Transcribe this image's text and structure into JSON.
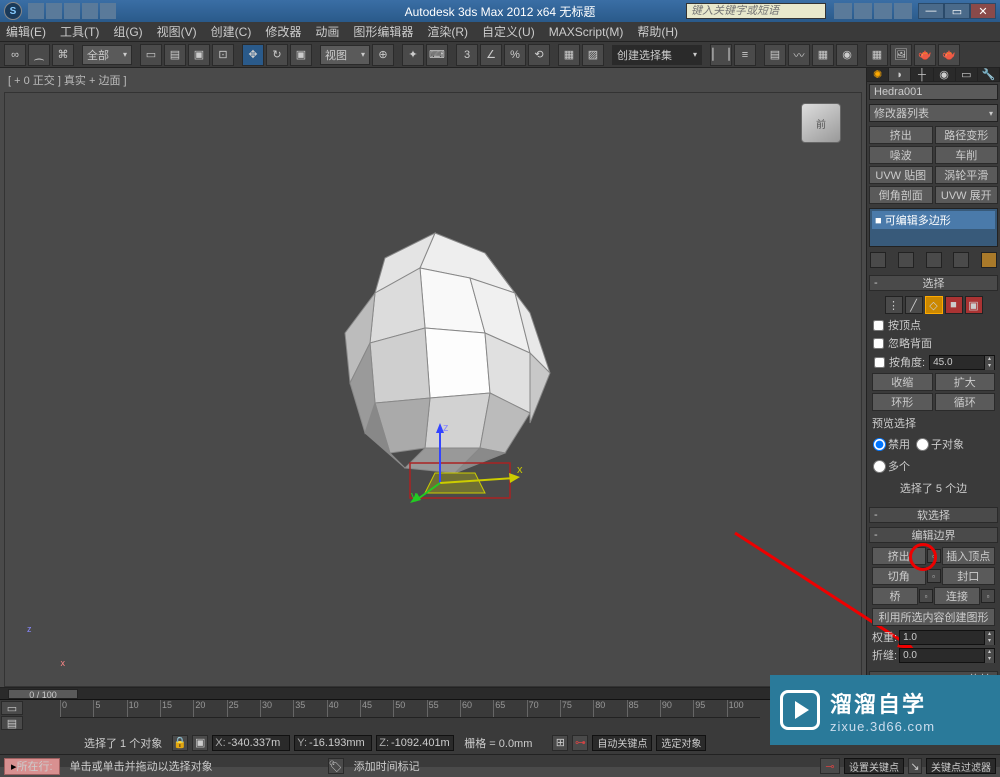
{
  "titlebar": {
    "app_title": "Autodesk 3ds Max 2012 x64   无标题",
    "search_placeholder": "键入关键字或短语",
    "app_icon_letter": "S"
  },
  "menu": {
    "items": [
      "编辑(E)",
      "工具(T)",
      "组(G)",
      "视图(V)",
      "创建(C)",
      "修改器",
      "动画",
      "图形编辑器",
      "渲染(R)",
      "自定义(U)",
      "MAXScript(M)",
      "帮助(H)"
    ]
  },
  "toolbar": {
    "all_dropdown": "全部",
    "view_dropdown": "视图",
    "selset_dropdown": "创建选择集"
  },
  "viewport": {
    "label": "[ + 0 正交 ] 真实 + 边面 ]",
    "cube_face": "前"
  },
  "panel": {
    "object_name": "Hedra001",
    "modlist_label": "修改器列表",
    "mod_buttons": [
      "挤出",
      "路径变形",
      "噪波",
      "车削",
      "UVW 贴图",
      "涡轮平滑",
      "倒角剖面",
      "UVW 展开"
    ],
    "stack_item": "■ 可编辑多边形",
    "sections": {
      "select": "选择",
      "soft": "软选择",
      "edit_border": "编辑边界",
      "rotate": "旋转"
    },
    "select": {
      "by_vertex": "按顶点",
      "ignore_back": "忽略背面",
      "by_angle": "按角度:",
      "angle_val": "45.0",
      "shrink": "收缩",
      "grow": "扩大",
      "ring": "环形",
      "loop": "循环",
      "preview_label": "预览选择",
      "r_disable": "禁用",
      "r_subobj": "子对象",
      "r_multi": "多个",
      "count_text": "选择了 5 个边"
    },
    "edit": {
      "extrude": "挤出",
      "insert_vert": "插入顶点",
      "chamfer": "切角",
      "cap": "封口",
      "bridge": "桥",
      "connect": "连接",
      "create_shape": "利用所选内容创建图形",
      "weight": "权重:",
      "weight_val": "1.0",
      "crease": "折缝:",
      "crease_val": "0.0"
    }
  },
  "status": {
    "sel_text": "选择了 1 个对象",
    "hint_text": "单击或单击并拖动以选择对象",
    "coord_x": "-340.337m",
    "coord_y": "-16.193mm",
    "coord_z": "-1092.401m",
    "grid": "栅格 = 0.0mm",
    "timeline_pos": "0 / 100",
    "add_time_marker": "添加时间标记",
    "auto_key": "自动关键点",
    "set_key": "设置关键点",
    "sel_filter": "选定对象",
    "key_filter": "关键点过滤器",
    "layer_label": "所在行:"
  },
  "watermark": {
    "main": "溜溜自学",
    "sub": "zixue.3d66.com"
  }
}
